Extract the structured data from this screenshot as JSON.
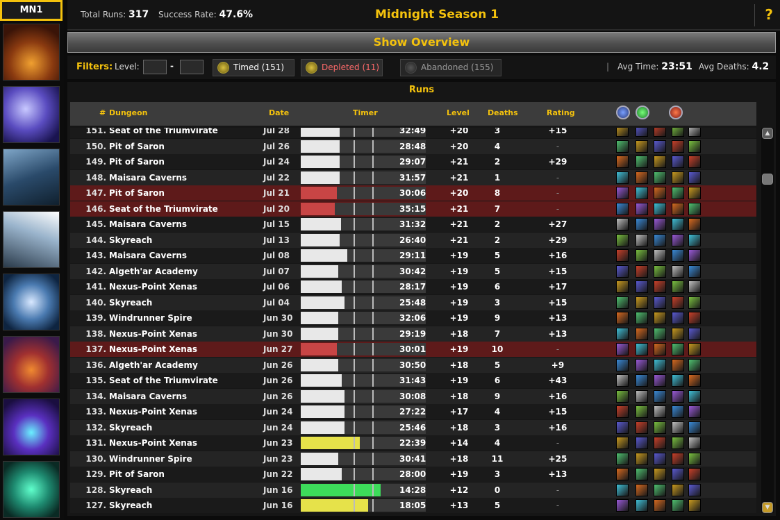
{
  "season_tab": "MN1",
  "header": {
    "total_runs_label": "Total Runs:",
    "total_runs": "317",
    "success_rate_label": "Success Rate:",
    "success_rate": "47.6%",
    "title": "Midnight Season 1",
    "help": "?"
  },
  "overview_button": "Show Overview",
  "filters": {
    "label": "Filters:",
    "level_label": "Level:",
    "level_min": "",
    "level_max": "",
    "dash": "-",
    "timed": "Timed  (151)",
    "depleted": "Depleted  (11)",
    "abandoned": "Abandoned  (155)",
    "sep": "|",
    "avg_time_label": "Avg Time:",
    "avg_time": "23:51",
    "avg_deaths_label": "Avg Deaths:",
    "avg_deaths": "4.2"
  },
  "runs": {
    "title": "Runs",
    "columns": {
      "num": "#",
      "dungeon": "Dungeon",
      "date": "Date",
      "timer": "Timer",
      "level": "Level",
      "deaths": "Deaths",
      "rating": "Rating"
    },
    "role_icons": [
      "tank-role-icon",
      "healer-role-icon",
      "dps-role-icon"
    ],
    "rows": [
      {
        "num": "151.",
        "dungeon": "Seat of the Triumvirate",
        "date": "Jul 28",
        "time": "32:49",
        "level": "+20",
        "deaths": "3",
        "rating": "+15",
        "status": "timed",
        "fill": 0.31
      },
      {
        "num": "150.",
        "dungeon": "Pit of Saron",
        "date": "Jul 26",
        "time": "28:48",
        "level": "+20",
        "deaths": "4",
        "rating": "-",
        "status": "timed",
        "fill": 0.31
      },
      {
        "num": "149.",
        "dungeon": "Pit of Saron",
        "date": "Jul 24",
        "time": "29:07",
        "level": "+21",
        "deaths": "2",
        "rating": "+29",
        "status": "timed",
        "fill": 0.31
      },
      {
        "num": "148.",
        "dungeon": "Maisara Caverns",
        "date": "Jul 22",
        "time": "31:57",
        "level": "+21",
        "deaths": "1",
        "rating": "-",
        "status": "timed",
        "fill": 0.31
      },
      {
        "num": "147.",
        "dungeon": "Pit of Saron",
        "date": "Jul 21",
        "time": "30:06",
        "level": "+20",
        "deaths": "8",
        "rating": "-",
        "status": "depleted",
        "fill": 0.29
      },
      {
        "num": "146.",
        "dungeon": "Seat of the Triumvirate",
        "date": "Jul 20",
        "time": "35:15",
        "level": "+21",
        "deaths": "7",
        "rating": "-",
        "status": "depleted",
        "fill": 0.27
      },
      {
        "num": "145.",
        "dungeon": "Maisara Caverns",
        "date": "Jul 15",
        "time": "31:32",
        "level": "+21",
        "deaths": "2",
        "rating": "+27",
        "status": "timed",
        "fill": 0.32
      },
      {
        "num": "144.",
        "dungeon": "Skyreach",
        "date": "Jul 13",
        "time": "26:40",
        "level": "+21",
        "deaths": "2",
        "rating": "+29",
        "status": "timed",
        "fill": 0.31
      },
      {
        "num": "143.",
        "dungeon": "Maisara Caverns",
        "date": "Jul 08",
        "time": "29:11",
        "level": "+19",
        "deaths": "5",
        "rating": "+16",
        "status": "timed",
        "fill": 0.37
      },
      {
        "num": "142.",
        "dungeon": "Algeth'ar Academy",
        "date": "Jul 07",
        "time": "30:42",
        "level": "+19",
        "deaths": "5",
        "rating": "+15",
        "status": "timed",
        "fill": 0.3
      },
      {
        "num": "141.",
        "dungeon": "Nexus-Point Xenas",
        "date": "Jul 06",
        "time": "28:17",
        "level": "+19",
        "deaths": "6",
        "rating": "+17",
        "status": "timed",
        "fill": 0.33
      },
      {
        "num": "140.",
        "dungeon": "Skyreach",
        "date": "Jul 04",
        "time": "25:48",
        "level": "+19",
        "deaths": "3",
        "rating": "+15",
        "status": "timed",
        "fill": 0.35
      },
      {
        "num": "139.",
        "dungeon": "Windrunner Spire",
        "date": "Jun 30",
        "time": "32:06",
        "level": "+19",
        "deaths": "9",
        "rating": "+13",
        "status": "timed",
        "fill": 0.3
      },
      {
        "num": "138.",
        "dungeon": "Nexus-Point Xenas",
        "date": "Jun 30",
        "time": "29:19",
        "level": "+18",
        "deaths": "7",
        "rating": "+13",
        "status": "timed",
        "fill": 0.3
      },
      {
        "num": "137.",
        "dungeon": "Nexus-Point Xenas",
        "date": "Jun 27",
        "time": "30:01",
        "level": "+19",
        "deaths": "10",
        "rating": "-",
        "status": "depleted",
        "fill": 0.29
      },
      {
        "num": "136.",
        "dungeon": "Algeth'ar Academy",
        "date": "Jun 26",
        "time": "30:50",
        "level": "+18",
        "deaths": "5",
        "rating": "+9",
        "status": "timed",
        "fill": 0.3
      },
      {
        "num": "135.",
        "dungeon": "Seat of the Triumvirate",
        "date": "Jun 26",
        "time": "31:43",
        "level": "+19",
        "deaths": "6",
        "rating": "+43",
        "status": "timed",
        "fill": 0.33
      },
      {
        "num": "134.",
        "dungeon": "Maisara Caverns",
        "date": "Jun 26",
        "time": "30:08",
        "level": "+18",
        "deaths": "9",
        "rating": "+16",
        "status": "timed",
        "fill": 0.35
      },
      {
        "num": "133.",
        "dungeon": "Nexus-Point Xenas",
        "date": "Jun 24",
        "time": "27:22",
        "level": "+17",
        "deaths": "4",
        "rating": "+15",
        "status": "timed",
        "fill": 0.35
      },
      {
        "num": "132.",
        "dungeon": "Skyreach",
        "date": "Jun 24",
        "time": "25:46",
        "level": "+18",
        "deaths": "3",
        "rating": "+16",
        "status": "timed",
        "fill": 0.35
      },
      {
        "num": "131.",
        "dungeon": "Nexus-Point Xenas",
        "date": "Jun 23",
        "time": "22:39",
        "level": "+14",
        "deaths": "4",
        "rating": "-",
        "status": "timed-2",
        "fill": 0.47
      },
      {
        "num": "130.",
        "dungeon": "Windrunner Spire",
        "date": "Jun 23",
        "time": "30:41",
        "level": "+18",
        "deaths": "11",
        "rating": "+25",
        "status": "timed",
        "fill": 0.3
      },
      {
        "num": "129.",
        "dungeon": "Pit of Saron",
        "date": "Jun 22",
        "time": "28:00",
        "level": "+19",
        "deaths": "3",
        "rating": "+13",
        "status": "timed",
        "fill": 0.33
      },
      {
        "num": "128.",
        "dungeon": "Skyreach",
        "date": "Jun 16",
        "time": "14:28",
        "level": "+12",
        "deaths": "0",
        "rating": "-",
        "status": "timed-3",
        "fill": 0.64
      },
      {
        "num": "127.",
        "dungeon": "Skyreach",
        "date": "Jun 16",
        "time": "18:05",
        "level": "+13",
        "deaths": "5",
        "rating": "-",
        "status": "timed-2",
        "fill": 0.54
      }
    ]
  },
  "colors": {
    "accent": "#f4c20d",
    "timed_fill": "#e8e8e8",
    "depleted_fill": "#c84545",
    "plus2_fill": "#e6e24a",
    "plus3_fill": "#3ddc5a",
    "depleted_row": "#5e1a1a"
  }
}
